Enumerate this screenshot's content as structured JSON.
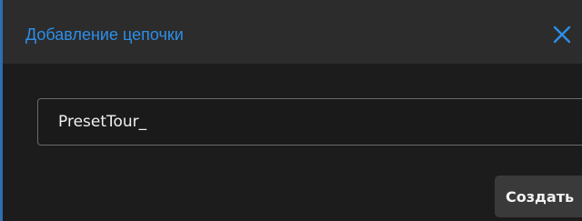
{
  "dialog": {
    "title": "Добавление цепочки",
    "close_icon": "close-icon",
    "name_input": {
      "value": "PresetTour_",
      "placeholder": ""
    },
    "create_label": "Создать"
  },
  "colors": {
    "title_text": "#2d8ee8",
    "accent_border": "#2e6eb1",
    "close_icon": "#2d8ee8",
    "titlebar_bg": "#2c2c2c",
    "body_bg": "#1c1c1c",
    "button_bg": "#3a3a3a"
  }
}
